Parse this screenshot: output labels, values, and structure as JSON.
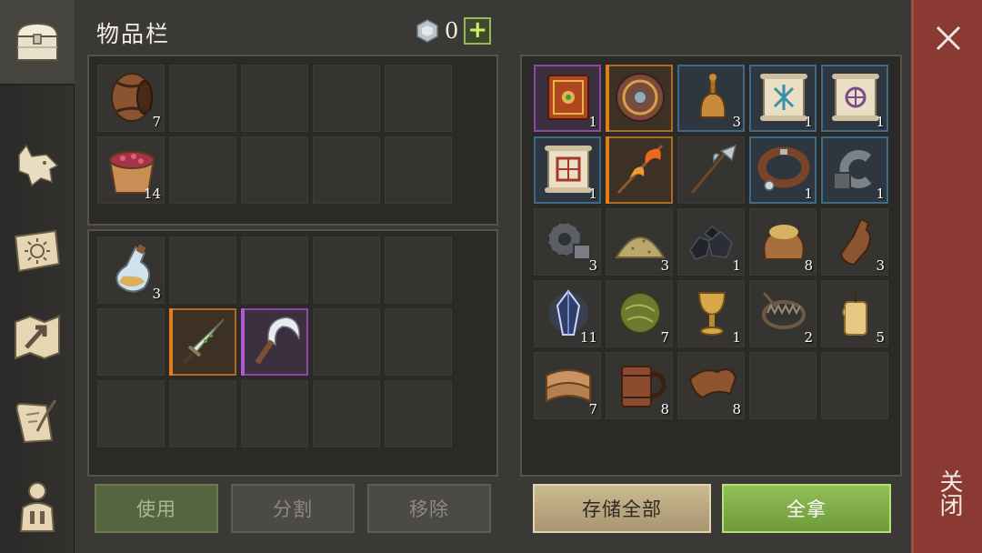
{
  "header": {
    "title": "物品栏",
    "currency_amount": "0",
    "currency_icon": "silver-coin-icon",
    "add_label": "+"
  },
  "sidebar": {
    "tabs": [
      {
        "name": "chest-icon",
        "active": true
      },
      {
        "name": "wolf-icon",
        "active": false
      },
      {
        "name": "sun-book-icon",
        "active": false
      },
      {
        "name": "map-arrow-icon",
        "active": false
      },
      {
        "name": "quest-scroll-icon",
        "active": false
      },
      {
        "name": "character-icon",
        "active": false
      }
    ]
  },
  "inventory": {
    "slots_top": [
      {
        "icon": "wooden-barrel-icon",
        "count": "7"
      },
      {
        "icon": "berry-bucket-icon",
        "count": "14"
      }
    ],
    "slots_bottom": [
      {
        "icon": "potion-flask-icon",
        "count": "3"
      },
      {
        "icon": "dagger-icon",
        "count": ""
      },
      {
        "icon": "sickle-icon",
        "count": ""
      }
    ],
    "buttons": {
      "use": "使用",
      "split": "分割",
      "remove": "移除"
    }
  },
  "storage": {
    "items": [
      {
        "icon": "ornate-book-icon",
        "count": "1"
      },
      {
        "icon": "round-shield-icon",
        "count": ""
      },
      {
        "icon": "bronze-bell-icon",
        "count": "3"
      },
      {
        "icon": "blue-rune-scroll-icon",
        "count": "1"
      },
      {
        "icon": "purple-rune-scroll-icon",
        "count": "1"
      },
      {
        "icon": "red-rune-scroll-icon",
        "count": "1"
      },
      {
        "icon": "flaming-spear-icon",
        "count": ""
      },
      {
        "icon": "halberd-icon",
        "count": ""
      },
      {
        "icon": "leather-collar-icon",
        "count": "1"
      },
      {
        "icon": "iron-shackle-icon",
        "count": "1"
      },
      {
        "icon": "gear-parts-icon",
        "count": "3"
      },
      {
        "icon": "sand-pile-icon",
        "count": "3"
      },
      {
        "icon": "coal-icon",
        "count": "1"
      },
      {
        "icon": "grain-sack-icon",
        "count": "8"
      },
      {
        "icon": "leather-bottle-icon",
        "count": "3"
      },
      {
        "icon": "blue-crystal-icon",
        "count": "11"
      },
      {
        "icon": "herb-ball-icon",
        "count": "7"
      },
      {
        "icon": "golden-goblet-icon",
        "count": "1"
      },
      {
        "icon": "bear-trap-icon",
        "count": "2"
      },
      {
        "icon": "wax-candle-icon",
        "count": "5"
      },
      {
        "icon": "cloth-roll-icon",
        "count": "7"
      },
      {
        "icon": "wooden-mug-icon",
        "count": "8"
      },
      {
        "icon": "leather-hide-icon",
        "count": "8"
      }
    ],
    "buttons": {
      "store_all": "存储全部",
      "take_all": "全拿"
    }
  },
  "close": {
    "label": "关闭"
  },
  "colors": {
    "rare_purple": "#8b48a8",
    "rare_orange": "#b06b22",
    "rare_blue": "#3d6a86",
    "take_green": "#7fae48",
    "close_red": "#8a3a33"
  }
}
